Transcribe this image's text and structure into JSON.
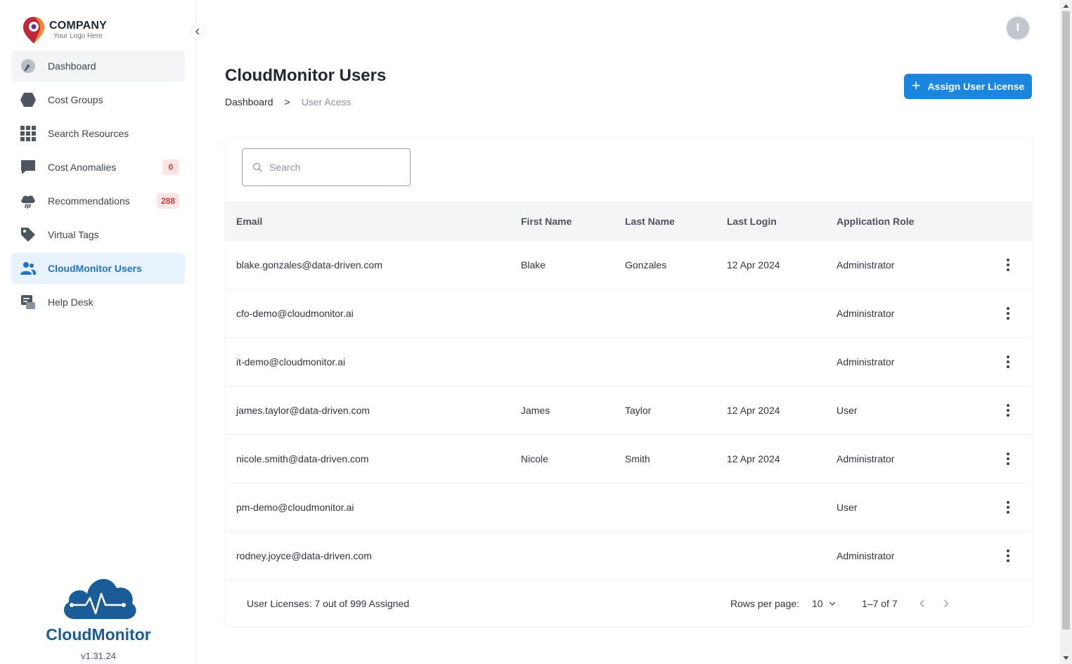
{
  "company": {
    "name": "COMPANY",
    "tagline": "Your Logo Here"
  },
  "sidebar": {
    "items": [
      {
        "label": "Dashboard",
        "icon": "gauge-icon",
        "badge": ""
      },
      {
        "label": "Cost Groups",
        "icon": "hexagon-icon",
        "badge": ""
      },
      {
        "label": "Search Resources",
        "icon": "grid-icon",
        "badge": ""
      },
      {
        "label": "Cost Anomalies",
        "icon": "chat-bubble-icon",
        "badge": "0"
      },
      {
        "label": "Recommendations",
        "icon": "cloud-rain-icon",
        "badge": "288"
      },
      {
        "label": "Virtual Tags",
        "icon": "tag-icon",
        "badge": ""
      },
      {
        "label": "CloudMonitor Users",
        "icon": "users-icon",
        "badge": "",
        "active": true
      },
      {
        "label": "Help Desk",
        "icon": "help-desk-icon",
        "badge": ""
      }
    ],
    "brand": "CloudMonitor",
    "version": "v1.31.24"
  },
  "header": {
    "avatar_initial": "I",
    "title": "CloudMonitor Users",
    "breadcrumb": {
      "home": "Dashboard",
      "separator": ">",
      "current": "User Acess"
    },
    "assign_button": "Assign User License"
  },
  "search": {
    "placeholder": "Search"
  },
  "table": {
    "columns": {
      "email": "Email",
      "first": "First Name",
      "last": "Last Name",
      "login": "Last Login",
      "role": "Application Role"
    },
    "rows": [
      {
        "email": "blake.gonzales@data-driven.com",
        "first": "Blake",
        "last": "Gonzales",
        "login": "12 Apr 2024",
        "role": "Administrator"
      },
      {
        "email": "cfo-demo@cloudmonitor.ai",
        "first": "",
        "last": "",
        "login": "",
        "role": "Administrator"
      },
      {
        "email": "it-demo@cloudmonitor.ai",
        "first": "",
        "last": "",
        "login": "",
        "role": "Administrator"
      },
      {
        "email": "james.taylor@data-driven.com",
        "first": "James",
        "last": "Taylor",
        "login": "12 Apr 2024",
        "role": "User"
      },
      {
        "email": "nicole.smith@data-driven.com",
        "first": "Nicole",
        "last": "Smith",
        "login": "12 Apr 2024",
        "role": "Administrator"
      },
      {
        "email": "pm-demo@cloudmonitor.ai",
        "first": "",
        "last": "",
        "login": "",
        "role": "User"
      },
      {
        "email": "rodney.joyce@data-driven.com",
        "first": "",
        "last": "",
        "login": "",
        "role": "Administrator"
      }
    ]
  },
  "footer": {
    "licenses": "User Licenses: 7 out of 999 Assigned",
    "rows_per_page_label": "Rows per page:",
    "rows_per_page_value": "10",
    "range": "1–7 of 7"
  },
  "colors": {
    "accent": "#1a86e0",
    "active_bg": "#e8f2fc",
    "badge_bg": "#fde5e5",
    "badge_text": "#d63b3b",
    "brand": "#1a5c97"
  }
}
